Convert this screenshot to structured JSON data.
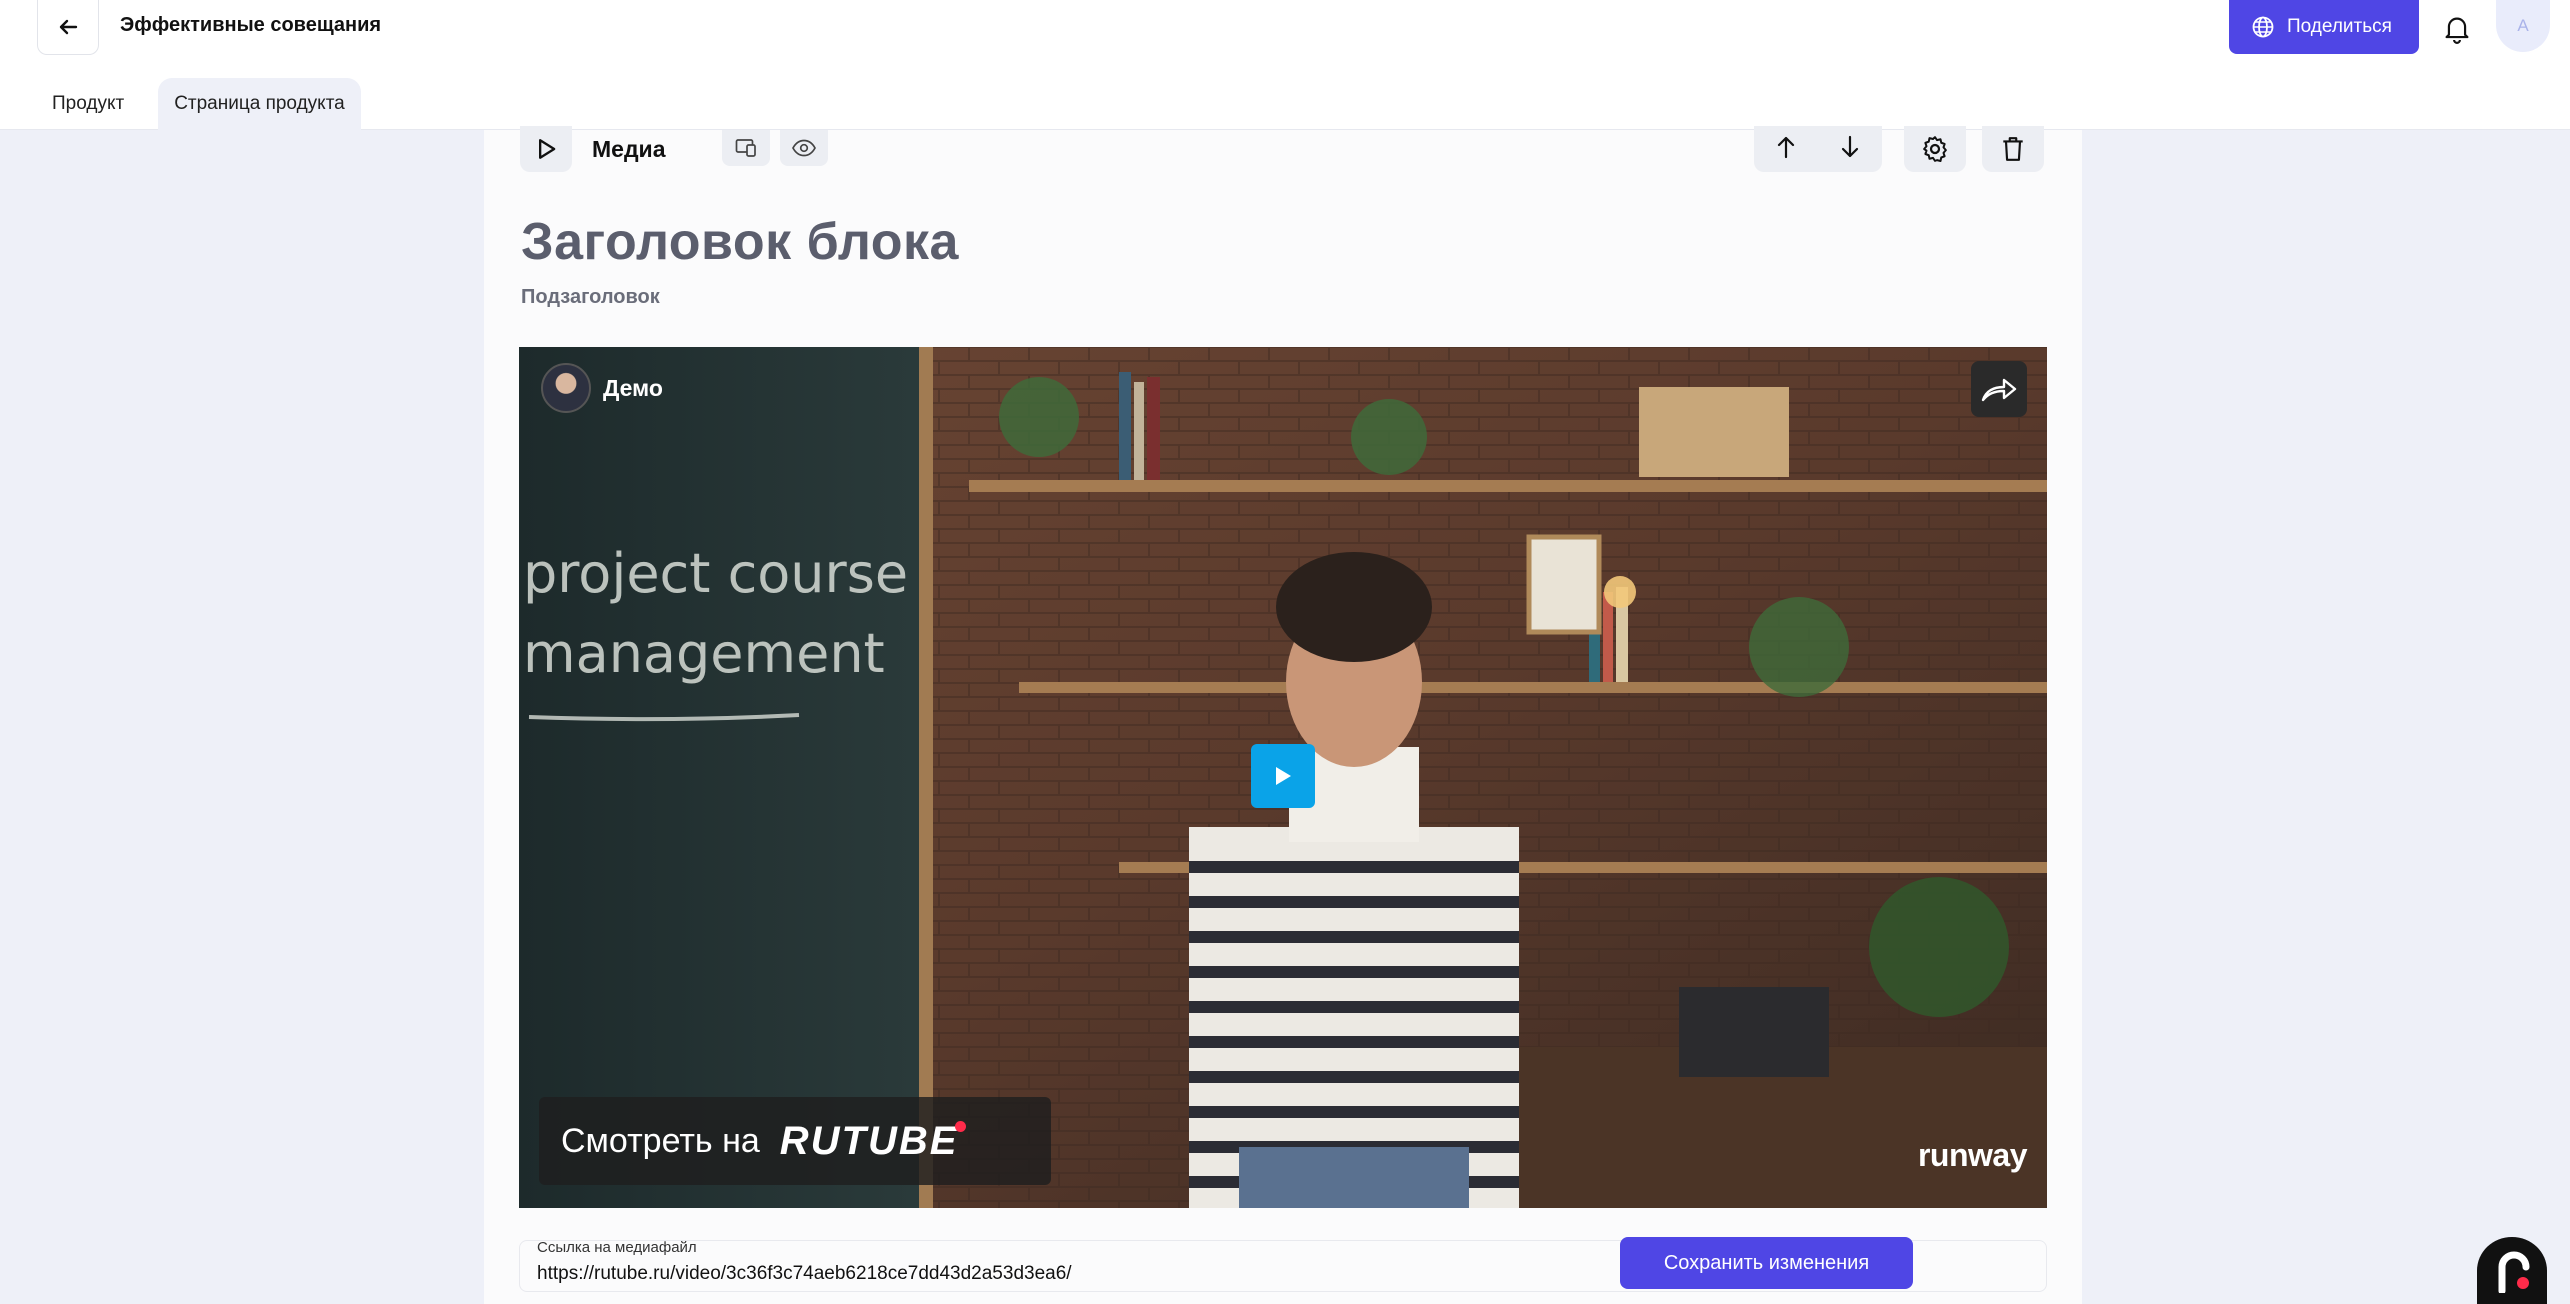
{
  "header": {
    "title": "Эффективные совещания",
    "share_label": "Поделиться",
    "avatar_initial": "A"
  },
  "tabs": [
    {
      "label": "Продукт"
    },
    {
      "label": "Страница продукта"
    }
  ],
  "block": {
    "type_label": "Медиа",
    "title": "Заголовок блока",
    "subtitle": "Подзаголовок"
  },
  "video": {
    "channel_name": "Демо",
    "watch_on": "Смотреть на",
    "platform": "RUTUBE",
    "watermark": "runway",
    "chalk_line1": "project course",
    "chalk_line2": "management"
  },
  "media_link": {
    "label": "Ссылка на медиафайл",
    "value": "https://rutube.ru/video/3c36f3c74aeb6218ce7dd43d2a53d3ea6/"
  },
  "actions": {
    "save_label": "Сохранить изменения"
  },
  "colors": {
    "accent": "#4f46e5",
    "page_bg": "#eef0f8",
    "play_blue": "#0aa3e8"
  }
}
